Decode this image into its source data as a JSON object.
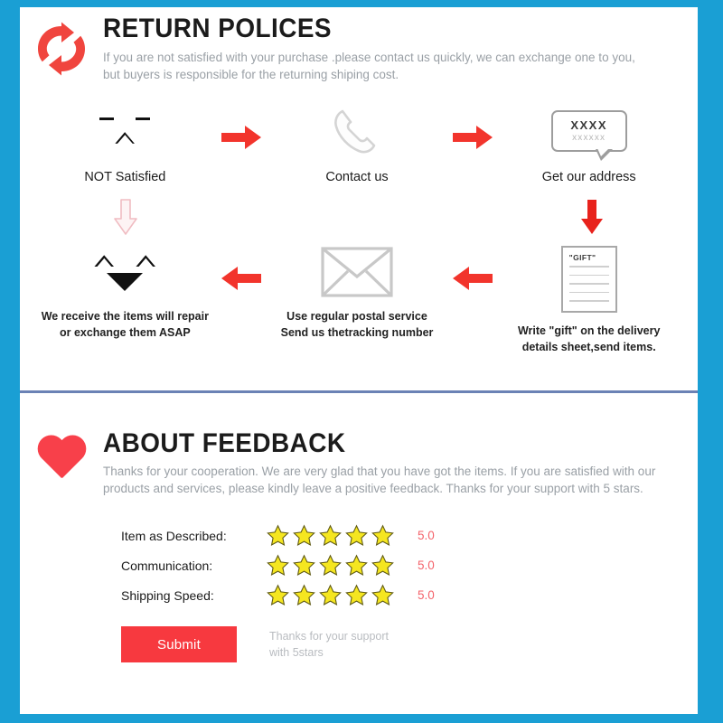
{
  "theme": {
    "border_blue": "#1a9fd4",
    "divider_blue": "#6b82b5",
    "accent_red": "#f7393f",
    "star_yellow": "#f5e620",
    "score_pink": "#f4636b",
    "muted_gray": "#9aa0a6"
  },
  "return_section": {
    "icon": "return-cycle-icon",
    "title": "RETURN POLICES",
    "subtitle_line1": "If you are not satisfied with your purchase .please contact us quickly, we can exchange one to you,",
    "subtitle_line2": "but buyers is responsible for the returning shiping cost.",
    "top_row": [
      {
        "icon": "sad-face-icon",
        "label": "NOT Satisfied"
      },
      {
        "icon": "phone-handset-icon",
        "label": "Contact us"
      },
      {
        "icon": "speech-bubble-icon",
        "label": "Get our address",
        "bubble_text_top": "XXXX",
        "bubble_text_bottom": "xxxxxx"
      }
    ],
    "top_arrows": [
      {
        "icon": "arrow-right-red-icon"
      },
      {
        "icon": "arrow-right-red-icon"
      }
    ],
    "connectors": [
      {
        "icon": "arrow-down-pink-icon",
        "position": "left"
      },
      {
        "icon": "arrow-down-red-icon",
        "position": "right"
      }
    ],
    "bottom_row": [
      {
        "icon": "happy-face-icon",
        "label_line1": "We receive the items will repair",
        "label_line2": "or exchange them ASAP"
      },
      {
        "icon": "envelope-icon",
        "label_line1": "Use regular postal service",
        "label_line2": "Send us thetracking number"
      },
      {
        "icon": "gift-document-icon",
        "label_line1": "Write \"gift\" on the delivery",
        "label_line2": "details sheet,send items.",
        "doc_title": "\"GIFT\""
      }
    ],
    "bottom_arrows": [
      {
        "icon": "arrow-left-red-icon"
      },
      {
        "icon": "arrow-left-red-icon"
      }
    ]
  },
  "feedback_section": {
    "icon": "heart-icon",
    "title": "ABOUT FEEDBACK",
    "subtitle_line1": "Thanks for your cooperation. We are very glad that you have got the items. If you are satisfied with our",
    "subtitle_line2": "products and services, please kindly leave a positive feedback. Thanks for your support with 5 stars.",
    "ratings": [
      {
        "label": "Item as Described:",
        "stars": 5,
        "score": "5.0"
      },
      {
        "label": "Communication:",
        "stars": 5,
        "score": "5.0"
      },
      {
        "label": "Shipping Speed:",
        "stars": 5,
        "score": "5.0"
      }
    ],
    "submit_label": "Submit",
    "submit_note_line1": "Thanks for your support",
    "submit_note_line2": "with 5stars"
  }
}
